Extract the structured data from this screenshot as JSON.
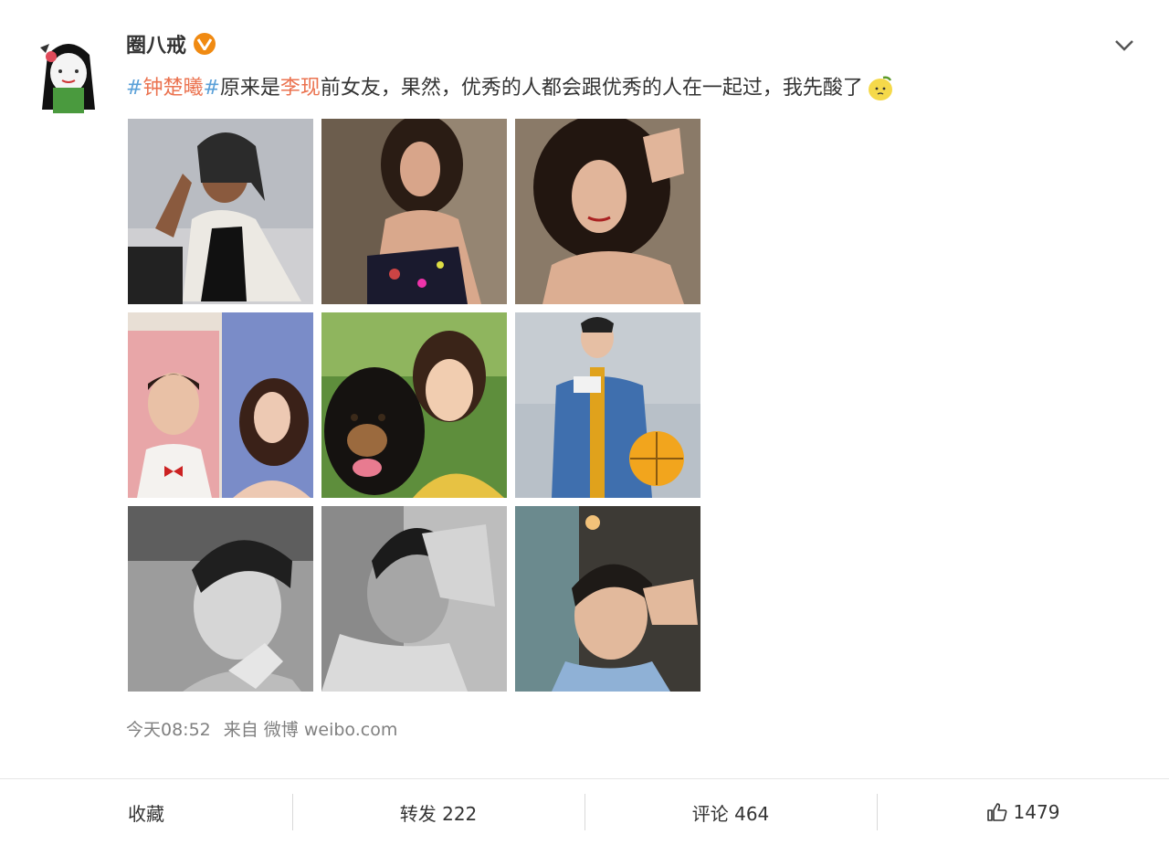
{
  "user": {
    "name": "圈八戒",
    "avatar_icon": "avatar-cartoon-girl-icon",
    "verified_icon": "verified-v-badge-icon",
    "verified_color": "#f08a12"
  },
  "post": {
    "hashtag_open": "#",
    "hashtag_text": "钟楚曦",
    "hashtag_close": "#",
    "text_part1": "原来是",
    "mention": "李现",
    "text_part2": "前女友，果然，优秀的人都会跟优秀的人在一起过，我先酸了",
    "emoji_icon": "lemon-face-emoji-icon",
    "photo_count": 9
  },
  "meta": {
    "time": "今天08:52",
    "source": "来自 微博 weibo.com"
  },
  "actions": {
    "favorite": "收藏",
    "repost": "转发 222",
    "comment": "评论 464",
    "like_count": "1479",
    "like_icon": "thumbs-up-icon"
  },
  "colors": {
    "hashtag": "#eb7350",
    "hash_symbol": "#5aa0d8",
    "meta_text": "#808080"
  }
}
